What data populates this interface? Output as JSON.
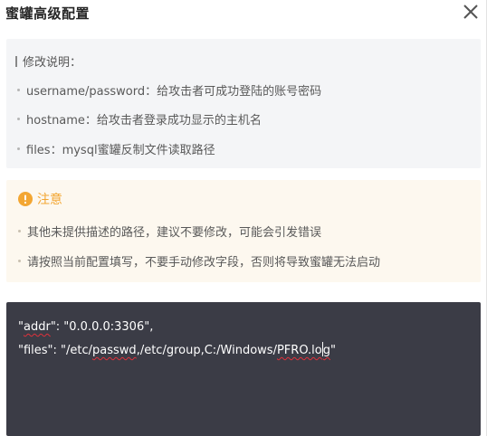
{
  "dialog": {
    "title": "蜜罐高级配置",
    "close_icon": "close-icon"
  },
  "description": {
    "title": "修改说明：",
    "items": [
      "username/password：给攻击者可成功登陆的账号密码",
      "hostname：给攻击者登录成功显示的主机名",
      "files：mysql蜜罐反制文件读取路径"
    ]
  },
  "notice": {
    "icon": "warning-icon",
    "accent_color": "#f3a632",
    "title": "注意",
    "items": [
      "其他未提供描述的路径，建议不要修改，可能会引发错误",
      "请按照当前配置填写，不要手动修改字段，否则将导致蜜罐无法启动"
    ]
  },
  "editor": {
    "background": "#3b3c46",
    "line1": {
      "q1": "\"",
      "key": "addr",
      "rest": "\": \"0.0.0.0:3306\","
    },
    "line2": {
      "pre": "\"files\": \"/etc/",
      "w1": "passwd",
      "mid": ",/etc/group,C:/Windows/",
      "w2": "PFRO.lo",
      "caret_after": "g",
      "end": "\""
    }
  }
}
